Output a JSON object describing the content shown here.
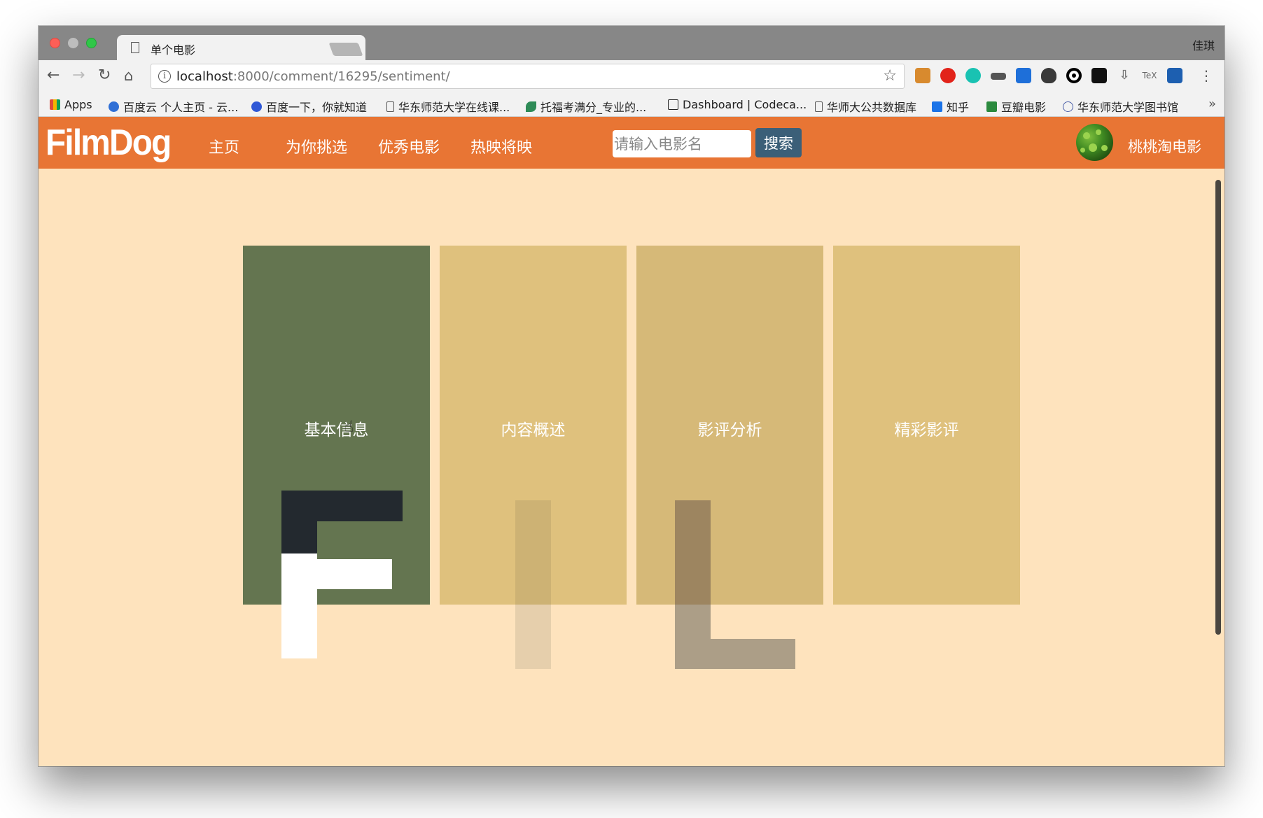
{
  "browser": {
    "tab_title": "单个电影",
    "tab_close": "×",
    "profile_name": "佳琪",
    "url_host": "localhost",
    "url_rest": ":8000/comment/16295/sentiment/",
    "bookmarks": [
      {
        "label": "Apps",
        "icon_color": "#e04a3a"
      },
      {
        "label": "百度云 个人主页 - 云...",
        "icon_color": "#2f6fd6"
      },
      {
        "label": "百度一下，你就知道",
        "icon_color": "#2f58d6"
      },
      {
        "label": "华东师范大学在线课...",
        "icon_color": "#ffffff"
      },
      {
        "label": "托福考满分_专业的...",
        "icon_color": "#2e8b57"
      },
      {
        "label": "Dashboard | Codeca...",
        "icon_color": "#ffffff"
      },
      {
        "label": "华师大公共数据库",
        "icon_color": "#ffffff"
      },
      {
        "label": "知乎",
        "icon_color": "#1a73e8"
      },
      {
        "label": "豆瓣电影",
        "icon_color": "#2b8a3e"
      },
      {
        "label": "华东师范大学图书馆",
        "icon_color": "#4a5ea8"
      }
    ],
    "bookmarks_more": "»"
  },
  "site": {
    "logo": "FilmDog",
    "nav": [
      "主页",
      "为你挑选",
      "优秀电影",
      "热映将映"
    ],
    "search_placeholder": "请输入电影名",
    "search_button": "搜索",
    "username": "桃桃淘电影"
  },
  "cards": [
    {
      "label": "基本信息",
      "color": "#647550"
    },
    {
      "label": "内容概述",
      "color": "#dfc17d"
    },
    {
      "label": "影评分析",
      "color": "#d6b978"
    },
    {
      "label": "精彩影评",
      "color": "#dfc17d"
    }
  ],
  "colors": {
    "header": "#e87534",
    "page_bg": "#fee3bd",
    "search_button": "#3b5f78"
  }
}
